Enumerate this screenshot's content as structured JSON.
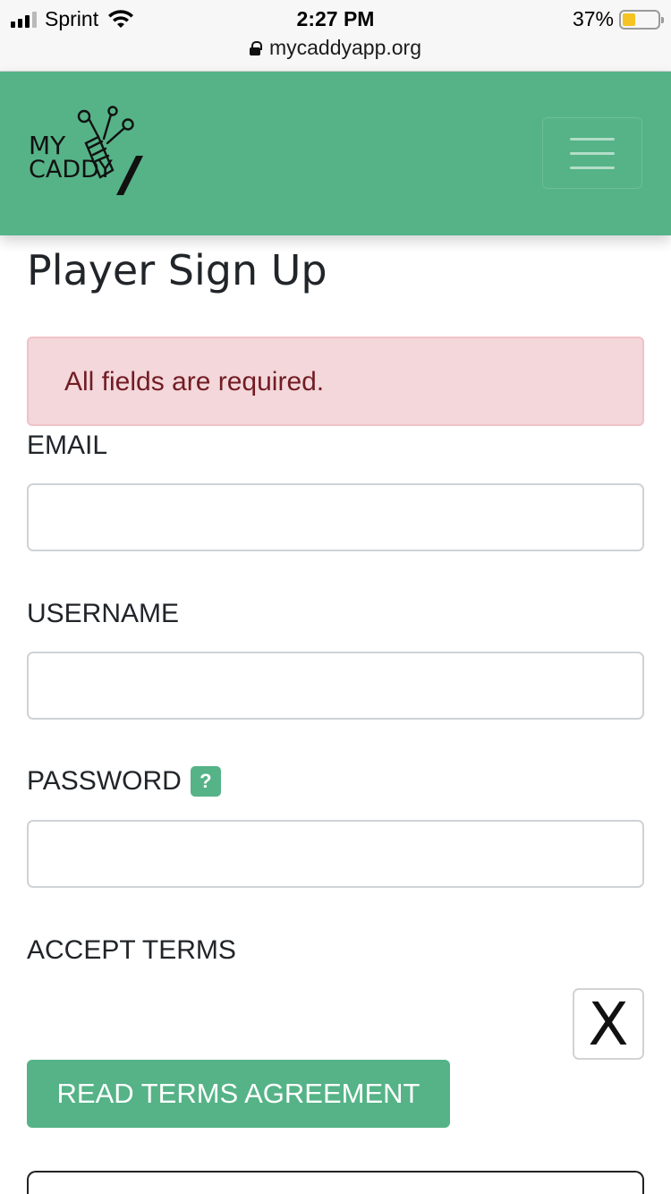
{
  "status_bar": {
    "carrier": "Sprint",
    "time": "2:27 PM",
    "battery_percent": "37%",
    "battery_level": 0.37,
    "url": "mycaddyapp.org",
    "icons": [
      "signal-icon",
      "wifi-icon",
      "battery-icon",
      "lock-icon"
    ]
  },
  "navbar": {
    "logo_text_top": "MY",
    "logo_text_bottom": "CADDY",
    "menu_icon": "hamburger-icon",
    "brand_color": "#55b387"
  },
  "page": {
    "title": "Player Sign Up",
    "alert": "All fields are required.",
    "alert_color": "#721c24"
  },
  "form": {
    "email_label": "EMAIL",
    "email_value": "",
    "username_label": "USERNAME",
    "username_value": "",
    "password_label": "PASSWORD",
    "password_help": "?",
    "password_value": "",
    "accept_terms_label": "ACCEPT TERMS",
    "accept_terms_mark": "X",
    "read_terms_button": "READ TERMS AGREEMENT"
  }
}
